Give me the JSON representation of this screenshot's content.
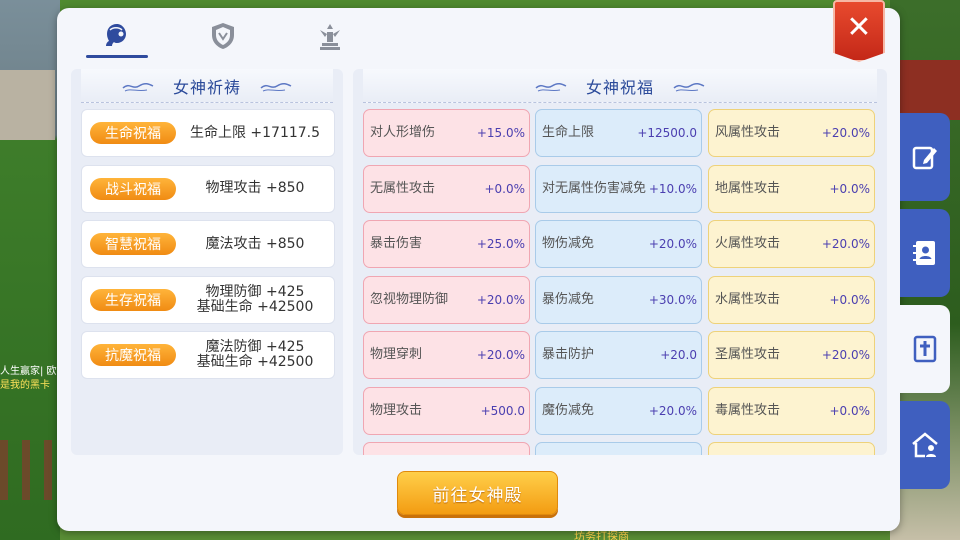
{
  "background": {
    "chat_line1": "人生赢家| 欧",
    "chat_line2": "是我的黑卡",
    "bottom_text": "坊务打探商"
  },
  "tabs": [
    {
      "icon": "goddess-head-icon",
      "active": true
    },
    {
      "icon": "shield-icon",
      "active": false
    },
    {
      "icon": "angel-statue-icon",
      "active": false
    }
  ],
  "close_label": "✕",
  "left_section": {
    "title": "女神祈祷",
    "items": [
      {
        "tag": "生命祝福",
        "value": "生命上限 +17117.5"
      },
      {
        "tag": "战斗祝福",
        "value": "物理攻击 +850"
      },
      {
        "tag": "智慧祝福",
        "value": "魔法攻击 +850"
      },
      {
        "tag": "生存祝福",
        "value": "物理防御 +425\n基础生命 +42500"
      },
      {
        "tag": "抗魔祝福",
        "value": "魔法防御 +425\n基础生命 +42500"
      }
    ]
  },
  "right_section": {
    "title": "女神祝福",
    "columns": [
      {
        "color": "pink",
        "cells": [
          {
            "name": "对人形增伤",
            "value": "+15.0%"
          },
          {
            "name": "无属性攻击",
            "value": "+0.0%"
          },
          {
            "name": "暴击伤害",
            "value": "+25.0%"
          },
          {
            "name": "忽视物理防御",
            "value": "+20.0%"
          },
          {
            "name": "物理穿刺",
            "value": "+20.0%"
          },
          {
            "name": "物理攻击",
            "value": "+500.0"
          },
          {
            "name": "",
            "value": ""
          }
        ]
      },
      {
        "color": "blue",
        "cells": [
          {
            "name": "生命上限",
            "value": "+12500.0"
          },
          {
            "name": "对无属性伤害减免",
            "value": "+10.0%"
          },
          {
            "name": "物伤减免",
            "value": "+20.0%"
          },
          {
            "name": "暴伤减免",
            "value": "+30.0%"
          },
          {
            "name": "暴击防护",
            "value": "+20.0"
          },
          {
            "name": "魔伤减免",
            "value": "+20.0%"
          },
          {
            "name": "",
            "value": ""
          }
        ]
      },
      {
        "color": "yellow",
        "cells": [
          {
            "name": "风属性攻击",
            "value": "+20.0%"
          },
          {
            "name": "地属性攻击",
            "value": "+0.0%"
          },
          {
            "name": "火属性攻击",
            "value": "+20.0%"
          },
          {
            "name": "水属性攻击",
            "value": "+0.0%"
          },
          {
            "name": "圣属性攻击",
            "value": "+20.0%"
          },
          {
            "name": "毒属性攻击",
            "value": "+0.0%"
          },
          {
            "name": "",
            "value": ""
          }
        ]
      }
    ]
  },
  "go_button": "前往女神殿",
  "side_tabs": [
    {
      "icon": "edit-icon",
      "active": false
    },
    {
      "icon": "contacts-book-icon",
      "active": false
    },
    {
      "icon": "cross-book-icon",
      "active": true
    },
    {
      "icon": "home-user-icon",
      "active": false
    }
  ],
  "colors": {
    "accent_blue": "#3f5fbf",
    "tag_orange": "#f08b13",
    "close_red": "#d4351e"
  }
}
